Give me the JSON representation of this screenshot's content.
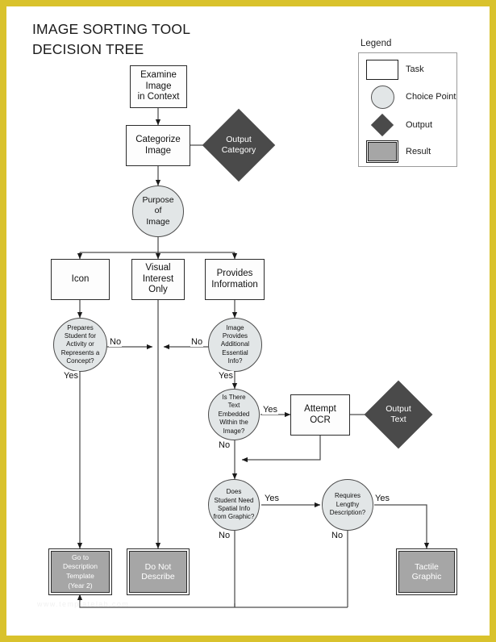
{
  "page": {
    "title": "IMAGE SORTING TOOL\nDECISION TREE",
    "border_color": "#d9c22c",
    "background": "#ffffff",
    "watermark": "www.templatelab.com"
  },
  "legend": {
    "title": "Legend",
    "items": [
      {
        "shape": "rectangle",
        "label": "Task",
        "color": "#ffffff"
      },
      {
        "shape": "circle",
        "label": "Choice Point",
        "color": "#e2e6e7"
      },
      {
        "shape": "diamond",
        "label": "Output",
        "color": "#4a4a4a"
      },
      {
        "shape": "rectangle-double",
        "label": "Result",
        "color": "#a6a6a6"
      }
    ]
  },
  "nodes": {
    "examine": {
      "label": "Examine\nImage\nin Context",
      "type": "task"
    },
    "categorize": {
      "label": "Categorize\nImage",
      "type": "task"
    },
    "output_category": {
      "label": "Output\nCategory",
      "type": "output"
    },
    "purpose": {
      "label": "Purpose\nof\nImage",
      "type": "choice"
    },
    "icon": {
      "label": "Icon",
      "type": "task"
    },
    "visual_interest": {
      "label": "Visual\nInterest\nOnly",
      "type": "task"
    },
    "provides_info": {
      "label": "Provides\nInformation",
      "type": "task"
    },
    "prepares_student": {
      "label": "Prepares\nStudent for\nActivity or\nRepresents a\nConcept?",
      "type": "choice"
    },
    "additional_info": {
      "label": "Image\nProvides\nAdditional\nEssential\nInfo?",
      "type": "choice"
    },
    "text_embedded": {
      "label": "Is There\nText\nEmbedded\nWithin the\nImage?",
      "type": "choice"
    },
    "attempt_ocr": {
      "label": "Attempt\nOCR",
      "type": "task"
    },
    "output_text": {
      "label": "Output\nText",
      "type": "output"
    },
    "spatial_info": {
      "label": "Does\nStudent Need\nSpatial Info\nfrom Graphic?",
      "type": "choice"
    },
    "lengthy_desc": {
      "label": "Requires\nLengthy\nDescription?",
      "type": "choice"
    },
    "description_template": {
      "label": "Go to\nDescription\nTemplate\n(Year 2)",
      "type": "result"
    },
    "do_not_describe": {
      "label": "Do Not\nDescribe",
      "type": "result"
    },
    "tactile_graphic": {
      "label": "Tactile\nGraphic",
      "type": "result"
    }
  },
  "edge_labels": {
    "prepares_no": "No",
    "prepares_yes": "Yes",
    "additional_no": "No",
    "additional_yes": "Yes",
    "text_yes": "Yes",
    "text_no": "No",
    "spatial_yes": "Yes",
    "spatial_no": "No",
    "lengthy_yes": "Yes",
    "lengthy_no": "No"
  }
}
